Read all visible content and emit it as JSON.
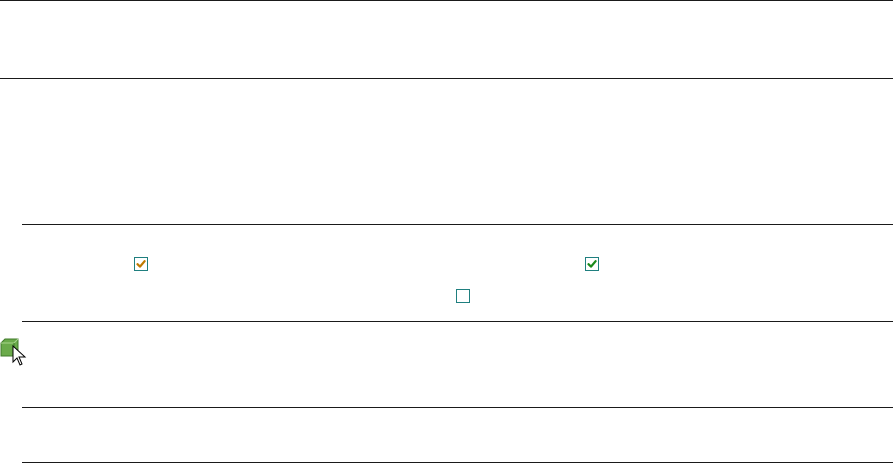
{
  "rows": [
    {
      "checkboxes": [
        {
          "state": "checked",
          "check_color": "#c07a00",
          "border_color": "#1f7f7f"
        },
        {
          "state": "checked",
          "check_color": "#1a8a1a",
          "border_color": "#1f7f7f"
        }
      ]
    },
    {
      "checkboxes": [
        {
          "state": "unchecked",
          "border_color": "#1f7f7f"
        }
      ]
    }
  ],
  "cursor": {
    "icon": "drag-move-cursor-icon",
    "box_color": "#6aaa4a"
  },
  "colors": {
    "divider": "#1a1a1a",
    "background": "#ffffff"
  }
}
